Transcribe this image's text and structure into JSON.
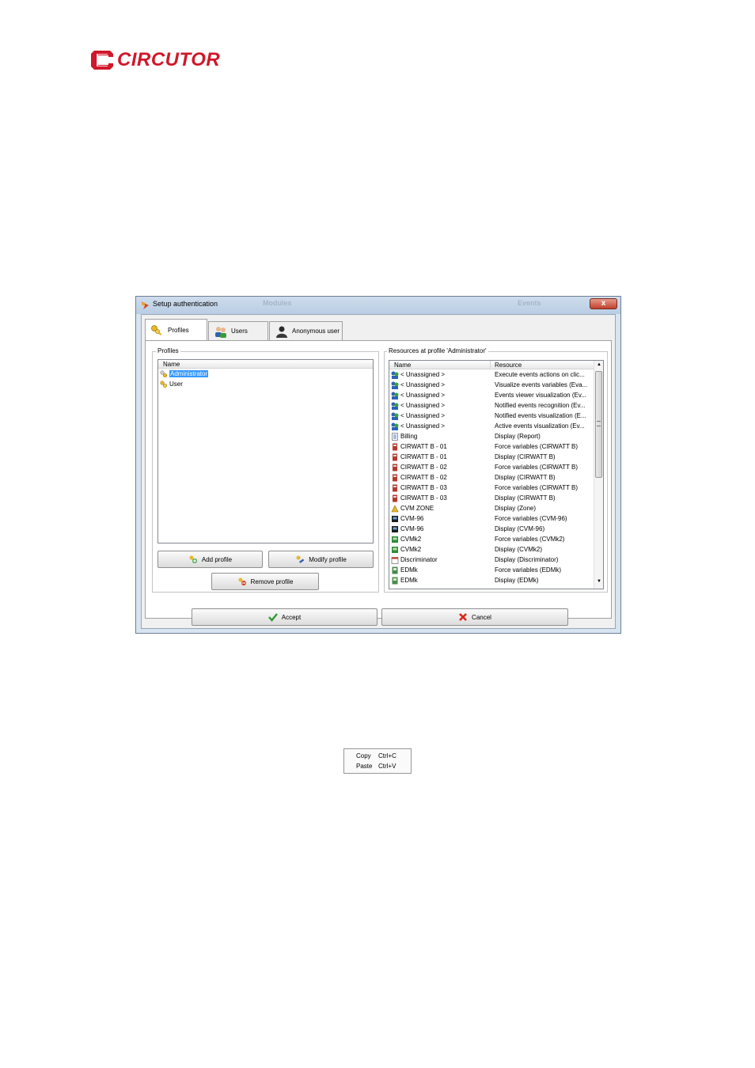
{
  "brand": {
    "name": "CIRCUTOR",
    "color": "#d0182a"
  },
  "window": {
    "title": "Setup authentication",
    "background_titles": [
      "Modules",
      "Events"
    ],
    "close_glyph": "x"
  },
  "tabs": [
    {
      "label": "Profiles",
      "icon": "keys-icon",
      "selected": true
    },
    {
      "label": "Users",
      "icon": "users-icon",
      "selected": false
    },
    {
      "label": "Anonymous user",
      "icon": "anonymous-user-icon",
      "selected": false
    }
  ],
  "profiles": {
    "group_label": "Profiles",
    "column": "Name",
    "items": [
      {
        "name": "Administrator",
        "icon": "admin-keys-icon",
        "selected": true
      },
      {
        "name": "User",
        "icon": "keys-icon",
        "selected": false
      }
    ],
    "buttons": {
      "add": "Add profile",
      "modify": "Modify profile",
      "remove": "Remove profile"
    }
  },
  "resources": {
    "group_label": "Resources at profile 'Administrator'",
    "columns": [
      "Name",
      "Resource"
    ],
    "rows": [
      {
        "name": "< Unassigned >",
        "resource": "Execute events actions on clic...",
        "icon": "unassigned-icon"
      },
      {
        "name": "< Unassigned >",
        "resource": "Visualize events variables (Eva...",
        "icon": "unassigned-icon"
      },
      {
        "name": "< Unassigned >",
        "resource": "Events viewer visualization (Ev...",
        "icon": "unassigned-icon"
      },
      {
        "name": "< Unassigned >",
        "resource": "Notified events recognition (Ev...",
        "icon": "unassigned-icon"
      },
      {
        "name": "< Unassigned >",
        "resource": "Notified events visualization (E...",
        "icon": "unassigned-icon"
      },
      {
        "name": "< Unassigned >",
        "resource": "Active events visualization (Ev...",
        "icon": "unassigned-icon"
      },
      {
        "name": "Billing",
        "resource": "Display (Report)",
        "icon": "report-icon"
      },
      {
        "name": "CIRWATT B - 01",
        "resource": "Force variables (CIRWATT B)",
        "icon": "meter-icon"
      },
      {
        "name": "CIRWATT B - 01",
        "resource": "Display (CIRWATT B)",
        "icon": "meter-icon"
      },
      {
        "name": "CIRWATT B - 02",
        "resource": "Force variables (CIRWATT B)",
        "icon": "meter-icon"
      },
      {
        "name": "CIRWATT B - 02",
        "resource": "Display (CIRWATT B)",
        "icon": "meter-icon"
      },
      {
        "name": "CIRWATT B - 03",
        "resource": "Force variables (CIRWATT B)",
        "icon": "meter-icon"
      },
      {
        "name": "CIRWATT B - 03",
        "resource": "Display (CIRWATT B)",
        "icon": "meter-icon"
      },
      {
        "name": "CVM ZONE",
        "resource": "Display (Zone)",
        "icon": "zone-icon"
      },
      {
        "name": "CVM-96",
        "resource": "Force variables (CVM-96)",
        "icon": "cvm96-icon"
      },
      {
        "name": "CVM-96",
        "resource": "Display (CVM-96)",
        "icon": "cvm96-icon"
      },
      {
        "name": "CVMk2",
        "resource": "Force variables (CVMk2)",
        "icon": "cvmk2-icon"
      },
      {
        "name": "CVMk2",
        "resource": "Display (CVMk2)",
        "icon": "cvmk2-icon"
      },
      {
        "name": "Discriminator",
        "resource": "Display (Discriminator)",
        "icon": "calendar-icon"
      },
      {
        "name": "EDMk",
        "resource": "Force variables (EDMk)",
        "icon": "edmk-icon"
      },
      {
        "name": "EDMk",
        "resource": "Display (EDMk)",
        "icon": "edmk-icon"
      }
    ]
  },
  "footer": {
    "accept": "Accept",
    "cancel": "Cancel"
  },
  "context_menu": [
    {
      "label": "Copy",
      "shortcut": "Ctrl+C"
    },
    {
      "label": "Paste",
      "shortcut": "Ctrl+V"
    }
  ],
  "colors": {
    "selection": "#3399ff",
    "title_bar": "#c4d5ea"
  }
}
